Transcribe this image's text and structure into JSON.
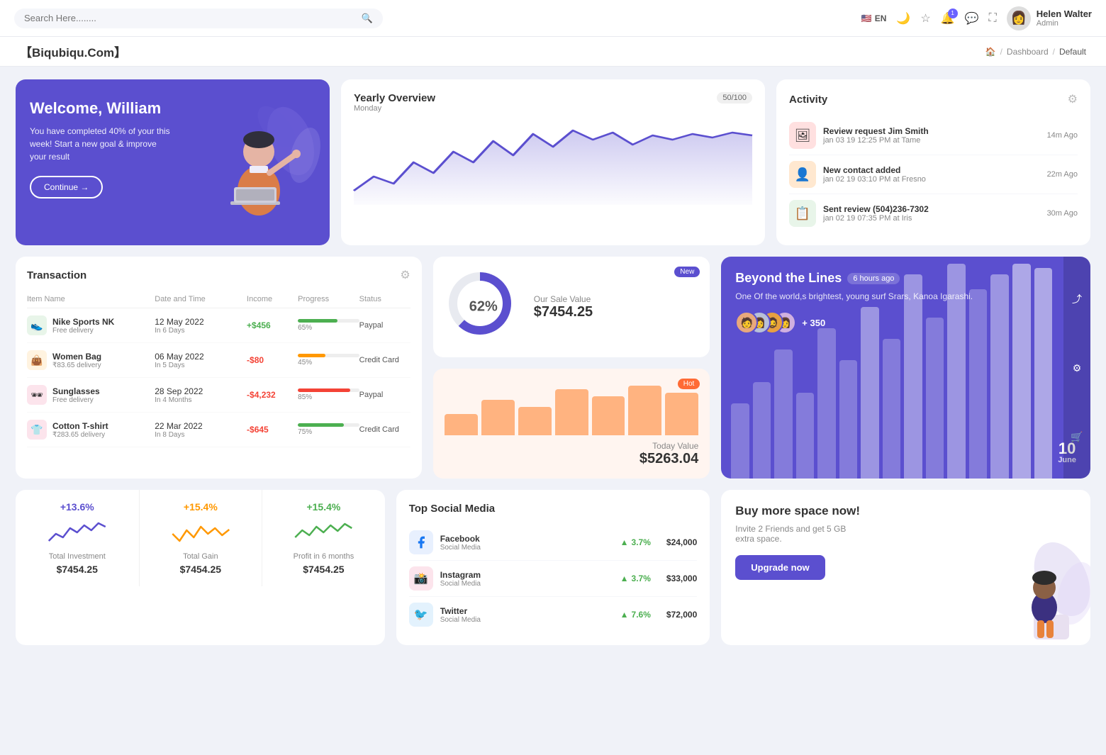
{
  "topnav": {
    "search_placeholder": "Search Here........",
    "lang": "EN",
    "user": {
      "name": "Helen Walter",
      "role": "Admin"
    },
    "icons": {
      "moon": "🌙",
      "star": "☆",
      "bell": "🔔",
      "chat": "💬",
      "expand": "⛶"
    },
    "bell_count": "1"
  },
  "breadcrumb": {
    "brand": "【Biqubiqu.Com】",
    "items": [
      "Home",
      "Dashboard",
      "Default"
    ]
  },
  "welcome": {
    "title": "Welcome, William",
    "description": "You have completed 40% of your this week! Start a new goal & improve your result",
    "button": "Continue →"
  },
  "yearly": {
    "title": "Yearly Overview",
    "subtitle": "Monday",
    "badge": "50/100",
    "chart_points": [
      20,
      40,
      30,
      55,
      35,
      65,
      50,
      80,
      60,
      90,
      70,
      95,
      75,
      85,
      65,
      78,
      88,
      72,
      82,
      90
    ]
  },
  "activity": {
    "title": "Activity",
    "items": [
      {
        "title": "Review request Jim Smith",
        "subtitle": "jan 03 19 12:25 PM at Tame",
        "time": "14m Ago",
        "emoji": "🖼"
      },
      {
        "title": "New contact added",
        "subtitle": "jan 02 19 03:10 PM at Fresno",
        "time": "22m Ago",
        "emoji": "👤"
      },
      {
        "title": "Sent review (504)236-7302",
        "subtitle": "jan 02 19 07:35 PM at Iris",
        "time": "30m Ago",
        "emoji": "📋"
      }
    ]
  },
  "transaction": {
    "title": "Transaction",
    "columns": [
      "Item Name",
      "Date and Time",
      "Income",
      "Progress",
      "Status"
    ],
    "rows": [
      {
        "name": "Nike Sports NK",
        "sub": "Free delivery",
        "date": "12 May 2022",
        "date_sub": "In 6 Days",
        "income": "+$456",
        "income_pos": true,
        "progress": 65,
        "progress_color": "#4caf50",
        "status": "Paypal",
        "emoji": "👟",
        "emoji_bg": "#e8f5e9"
      },
      {
        "name": "Women Bag",
        "sub": "₹83.65 delivery",
        "date": "06 May 2022",
        "date_sub": "In 5 Days",
        "income": "-$80",
        "income_pos": false,
        "progress": 45,
        "progress_color": "#ff9800",
        "status": "Credit Card",
        "emoji": "👜",
        "emoji_bg": "#fff3e0"
      },
      {
        "name": "Sunglasses",
        "sub": "Free delivery",
        "date": "28 Sep 2022",
        "date_sub": "In 4 Months",
        "income": "-$4,232",
        "income_pos": false,
        "progress": 85,
        "progress_color": "#f44336",
        "status": "Paypal",
        "emoji": "🕶",
        "emoji_bg": "#fce4ec"
      },
      {
        "name": "Cotton T-shirt",
        "sub": "₹283.65 delivery",
        "date": "22 Mar 2022",
        "date_sub": "In 8 Days",
        "income": "-$645",
        "income_pos": false,
        "progress": 75,
        "progress_color": "#4caf50",
        "status": "Credit Card",
        "emoji": "👕",
        "emoji_bg": "#fce4ec"
      }
    ]
  },
  "sale": {
    "badge": "New",
    "percent": "62%",
    "label": "Our Sale Value",
    "value": "$7454.25",
    "donut_filled": 62,
    "donut_empty": 38
  },
  "today": {
    "badge": "Hot",
    "label": "Today Value",
    "value": "$5263.04",
    "bars": [
      30,
      50,
      40,
      65,
      55,
      70,
      60
    ]
  },
  "beyond": {
    "title": "Beyond the Lines",
    "time": "6 hours ago",
    "desc": "One Of the world,s brightest, young surf Srars, Kanoa Igarashi.",
    "plus_count": "+ 350",
    "date": "10",
    "month": "June",
    "avatars": [
      "🧑",
      "👩",
      "🧔",
      "👩"
    ],
    "bars": [
      40,
      60,
      80,
      50,
      90,
      70,
      110,
      85,
      130,
      100,
      150,
      120,
      160,
      140,
      155
    ]
  },
  "stats": [
    {
      "percent": "+13.6%",
      "color": "purple",
      "label": "Total Investment",
      "value": "$7454.25"
    },
    {
      "percent": "+15.4%",
      "color": "orange",
      "label": "Total Gain",
      "value": "$7454.25"
    },
    {
      "percent": "+15.4%",
      "color": "green",
      "label": "Profit in 6 months",
      "value": "$7454.25"
    }
  ],
  "social": {
    "title": "Top Social Media",
    "items": [
      {
        "name": "Facebook",
        "sub": "Social Media",
        "icon": "f",
        "icon_bg": "#1877f2",
        "growth": "3.7%",
        "value": "$24,000"
      },
      {
        "name": "Instagram",
        "sub": "Social Media",
        "icon": "📸",
        "icon_bg": "#e1306c",
        "growth": "3.7%",
        "value": "$33,000"
      },
      {
        "name": "Twitter",
        "sub": "Social Media",
        "icon": "🐦",
        "icon_bg": "#1da1f2",
        "growth": "7.6%",
        "value": "$72,000"
      }
    ]
  },
  "upgrade": {
    "title": "Buy more space now!",
    "desc": "Invite 2 Friends and get 5 GB extra space.",
    "button": "Upgrade now"
  }
}
